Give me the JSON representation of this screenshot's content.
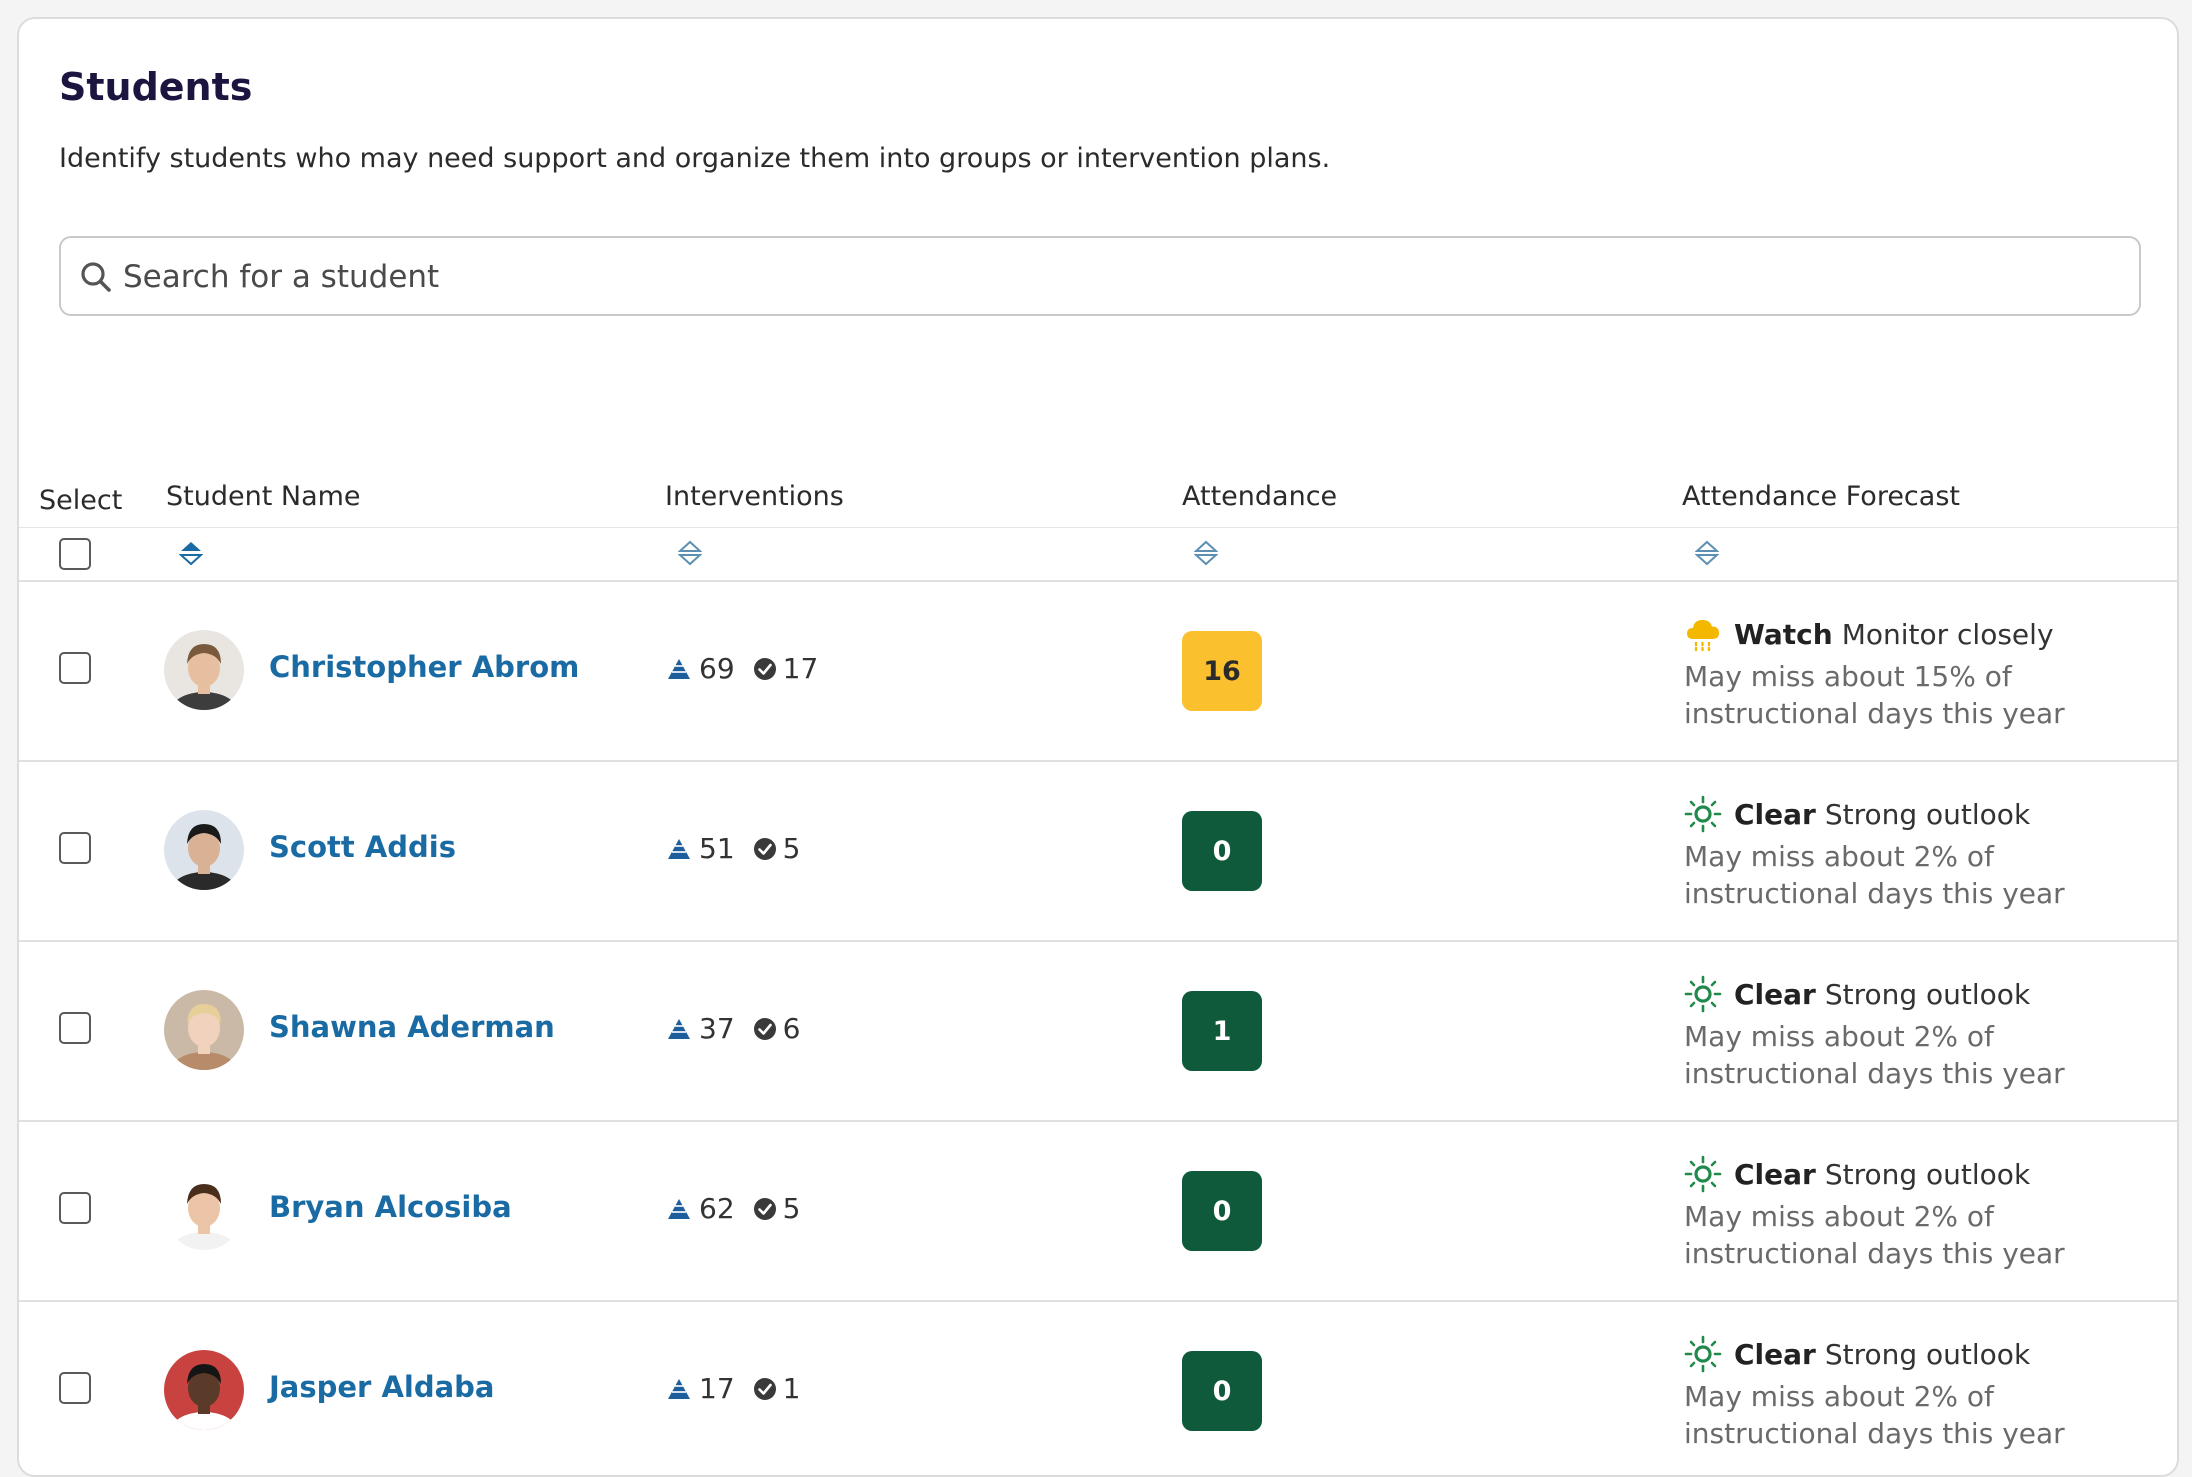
{
  "page": {
    "title": "Students",
    "subtitle": "Identify students who may need support and organize them into groups or intervention plans."
  },
  "search": {
    "placeholder": "Search for a student",
    "value": ""
  },
  "table": {
    "columns": {
      "select": "Select",
      "name": "Student Name",
      "interventions": "Interventions",
      "attendance": "Attendance",
      "forecast": "Attendance Forecast"
    },
    "rows": [
      {
        "name": "Christopher Abrom",
        "interventions_total": "69",
        "interventions_done": "17",
        "attendance": "16",
        "attendance_color": "#fbc02d",
        "attendance_text_color": "#2b2b2b",
        "forecast_icon": "rain-cloud-icon",
        "forecast_status": "Watch",
        "forecast_outlook": "Monitor closely",
        "forecast_detail": "May miss about 15% of instructional days this year",
        "avatar_palette": {
          "bg": "#e9e6e2",
          "hair": "#7a5a3c",
          "skin": "#e6bfa0",
          "shirt": "#3d3d3d"
        }
      },
      {
        "name": "Scott Addis",
        "interventions_total": "51",
        "interventions_done": "5",
        "attendance": "0",
        "attendance_color": "#0e5a3a",
        "attendance_text_color": "#ffffff",
        "forecast_icon": "sun-icon",
        "forecast_status": "Clear",
        "forecast_outlook": "Strong outlook",
        "forecast_detail": "May miss about 2% of instructional days this year",
        "avatar_palette": {
          "bg": "#dde3ea",
          "hair": "#1a1a1a",
          "skin": "#d9b195",
          "shirt": "#2a2a2a"
        }
      },
      {
        "name": "Shawna Aderman",
        "interventions_total": "37",
        "interventions_done": "6",
        "attendance": "1",
        "attendance_color": "#0e5a3a",
        "attendance_text_color": "#ffffff",
        "forecast_icon": "sun-icon",
        "forecast_status": "Clear",
        "forecast_outlook": "Strong outlook",
        "forecast_detail": "May miss about 2% of instructional days this year",
        "avatar_palette": {
          "bg": "#c9b9a6",
          "hair": "#e7cf9a",
          "skin": "#f1d2bd",
          "shirt": "#b88c6a"
        }
      },
      {
        "name": "Bryan Alcosiba",
        "interventions_total": "62",
        "interventions_done": "5",
        "attendance": "0",
        "attendance_color": "#0e5a3a",
        "attendance_text_color": "#ffffff",
        "forecast_icon": "sun-icon",
        "forecast_status": "Clear",
        "forecast_outlook": "Strong outlook",
        "forecast_detail": "May miss about 2% of instructional days this year",
        "avatar_palette": {
          "bg": "#ffffff",
          "hair": "#4a2e1c",
          "skin": "#ecc4a8",
          "shirt": "#f2f2f2"
        }
      },
      {
        "name": "Jasper Aldaba",
        "interventions_total": "17",
        "interventions_done": "1",
        "attendance": "0",
        "attendance_color": "#0e5a3a",
        "attendance_text_color": "#ffffff",
        "forecast_icon": "sun-icon",
        "forecast_status": "Clear",
        "forecast_outlook": "Strong outlook",
        "forecast_detail": "May miss about 2% of instructional days this year",
        "avatar_palette": {
          "bg": "#c8433f",
          "hair": "#151515",
          "skin": "#5a3a28",
          "shirt": "#ffffff"
        }
      }
    ]
  },
  "colors": {
    "link": "#1a6ba3",
    "sort_active": "#1a6ba3",
    "sort_inactive": "#5d8fb3",
    "title": "#1b1540",
    "sun": "#1f8a4c",
    "cloud": "#f5b800",
    "intervention_icon": "#1d5f9c",
    "check_icon": "#3a3a3a"
  }
}
